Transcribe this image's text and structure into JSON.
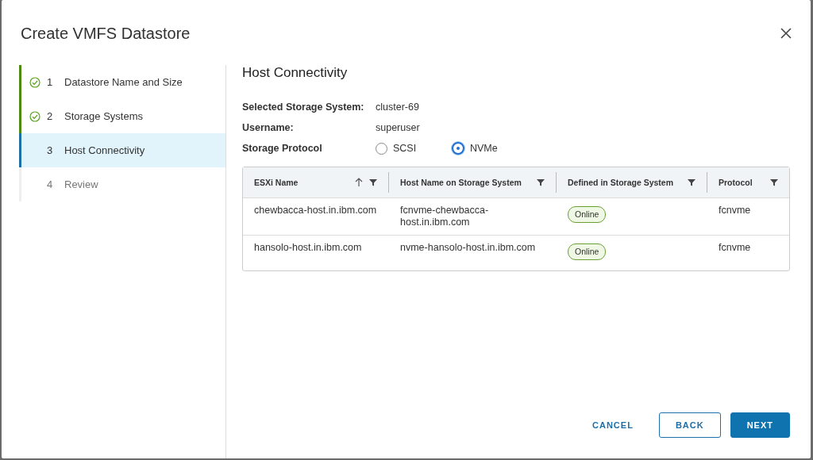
{
  "dialog": {
    "title": "Create VMFS Datastore"
  },
  "steps": [
    {
      "number": "1",
      "label": "Datastore Name and Size",
      "completed": true,
      "selected": false
    },
    {
      "number": "2",
      "label": "Storage Systems",
      "completed": true,
      "selected": false
    },
    {
      "number": "3",
      "label": "Host Connectivity",
      "completed": false,
      "selected": true
    },
    {
      "number": "4",
      "label": "Review",
      "completed": false,
      "selected": false
    }
  ],
  "page": {
    "title": "Host Connectivity",
    "fields": [
      {
        "label": "Selected Storage System:",
        "value": "cluster-69"
      },
      {
        "label": "Username:",
        "value": "superuser"
      }
    ],
    "protocol": {
      "label": "Storage Protocol",
      "options": [
        {
          "label": "SCSI",
          "selected": false
        },
        {
          "label": "NVMe",
          "selected": true
        }
      ]
    },
    "table": {
      "columns": [
        {
          "label": "ESXi Name",
          "sorted": true
        },
        {
          "label": "Host Name on Storage System",
          "sorted": false
        },
        {
          "label": "Defined in Storage System",
          "sorted": false
        },
        {
          "label": "Protocol",
          "sorted": false
        }
      ],
      "rows": [
        {
          "esxi_name": "chewbacca-host.in.ibm.com",
          "host_name": "fcnvme-chewbacca-host.in.ibm.com",
          "defined": "Online",
          "protocol": "fcnvme"
        },
        {
          "esxi_name": "hansolo-host.in.ibm.com",
          "host_name": "nvme-hansolo-host.in.ibm.com",
          "defined": "Online",
          "protocol": "fcnvme"
        }
      ]
    }
  },
  "buttons": [
    {
      "label": "CANCEL",
      "kind": "flat"
    },
    {
      "label": "BACK",
      "kind": "outline"
    },
    {
      "label": "NEXT",
      "kind": "primary"
    }
  ]
}
